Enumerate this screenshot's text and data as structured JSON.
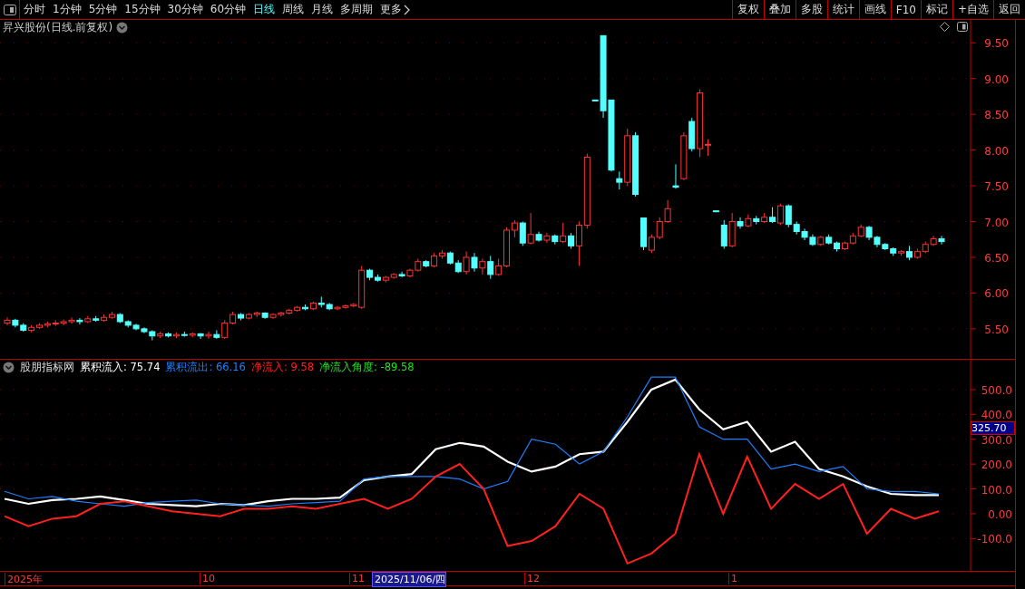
{
  "toolbar": {
    "periods": [
      {
        "label": "分时",
        "selected": false
      },
      {
        "label": "1分钟",
        "selected": false
      },
      {
        "label": "5分钟",
        "selected": false
      },
      {
        "label": "15分钟",
        "selected": false
      },
      {
        "label": "30分钟",
        "selected": false
      },
      {
        "label": "60分钟",
        "selected": false
      },
      {
        "label": "日线",
        "selected": true
      },
      {
        "label": "周线",
        "selected": false
      },
      {
        "label": "月线",
        "selected": false
      },
      {
        "label": "多周期",
        "selected": false
      },
      {
        "label": "更多",
        "selected": false
      }
    ],
    "actions": [
      "复权",
      "叠加",
      "多股",
      "统计",
      "画线",
      "F10",
      "标记",
      "+自选",
      "返回"
    ]
  },
  "main_chart": {
    "title": "昇兴股份(日线.前复权)",
    "chart_data": {
      "type": "candlestick",
      "ylim": [
        5.08,
        9.82
      ],
      "grid": true,
      "yticks": [
        {
          "value": 9.5,
          "label": "9.50"
        },
        {
          "value": 9,
          "label": "9.00"
        },
        {
          "value": 8.5,
          "label": "8.50"
        },
        {
          "value": 8,
          "label": "8.00"
        },
        {
          "value": 7.5,
          "label": "7.50"
        },
        {
          "value": 7,
          "label": "7.00"
        },
        {
          "value": 6.5,
          "label": "6.50"
        },
        {
          "value": 6,
          "label": "6.00"
        },
        {
          "value": 5.5,
          "label": "5.50"
        }
      ],
      "ohlc": [
        [
          5.58,
          5.66,
          5.55,
          5.62
        ],
        [
          5.62,
          5.64,
          5.52,
          5.55
        ],
        [
          5.55,
          5.58,
          5.46,
          5.48
        ],
        [
          5.48,
          5.55,
          5.45,
          5.52
        ],
        [
          5.52,
          5.58,
          5.5,
          5.55
        ],
        [
          5.55,
          5.6,
          5.52,
          5.57
        ],
        [
          5.57,
          5.62,
          5.54,
          5.58
        ],
        [
          5.58,
          5.63,
          5.55,
          5.6
        ],
        [
          5.6,
          5.66,
          5.57,
          5.62
        ],
        [
          5.62,
          5.65,
          5.56,
          5.6
        ],
        [
          5.6,
          5.68,
          5.58,
          5.64
        ],
        [
          5.64,
          5.68,
          5.6,
          5.62
        ],
        [
          5.62,
          5.7,
          5.6,
          5.66
        ],
        [
          5.66,
          5.74,
          5.64,
          5.7
        ],
        [
          5.7,
          5.72,
          5.58,
          5.6
        ],
        [
          5.6,
          5.62,
          5.52,
          5.55
        ],
        [
          5.55,
          5.57,
          5.48,
          5.5
        ],
        [
          5.5,
          5.52,
          5.44,
          5.46
        ],
        [
          5.46,
          5.48,
          5.34,
          5.4
        ],
        [
          5.4,
          5.46,
          5.37,
          5.43
        ],
        [
          5.43,
          5.45,
          5.38,
          5.4
        ],
        [
          5.4,
          5.45,
          5.37,
          5.42
        ],
        [
          5.42,
          5.46,
          5.39,
          5.41
        ],
        [
          5.41,
          5.45,
          5.38,
          5.43
        ],
        [
          5.43,
          5.44,
          5.36,
          5.4
        ],
        [
          5.4,
          5.46,
          5.36,
          5.42
        ],
        [
          5.42,
          5.48,
          5.36,
          5.38
        ],
        [
          5.38,
          5.62,
          5.36,
          5.58
        ],
        [
          5.58,
          5.74,
          5.56,
          5.7
        ],
        [
          5.7,
          5.72,
          5.62,
          5.65
        ],
        [
          5.65,
          5.72,
          5.63,
          5.7
        ],
        [
          5.7,
          5.74,
          5.66,
          5.72
        ],
        [
          5.72,
          5.73,
          5.64,
          5.66
        ],
        [
          5.66,
          5.72,
          5.64,
          5.7
        ],
        [
          5.7,
          5.74,
          5.67,
          5.72
        ],
        [
          5.72,
          5.78,
          5.7,
          5.76
        ],
        [
          5.76,
          5.82,
          5.74,
          5.8
        ],
        [
          5.8,
          5.84,
          5.76,
          5.78
        ],
        [
          5.78,
          5.88,
          5.76,
          5.86
        ],
        [
          5.86,
          5.95,
          5.8,
          5.84
        ],
        [
          5.84,
          5.86,
          5.76,
          5.78
        ],
        [
          5.78,
          5.82,
          5.76,
          5.8
        ],
        [
          5.8,
          5.84,
          5.78,
          5.82
        ],
        [
          5.82,
          5.86,
          5.8,
          5.84
        ],
        [
          5.8,
          6.38,
          5.78,
          6.32
        ],
        [
          6.32,
          6.34,
          6.18,
          6.22
        ],
        [
          6.22,
          6.26,
          6.16,
          6.18
        ],
        [
          6.18,
          6.24,
          6.15,
          6.22
        ],
        [
          6.22,
          6.28,
          6.2,
          6.26
        ],
        [
          6.26,
          6.3,
          6.22,
          6.24
        ],
        [
          6.24,
          6.34,
          6.22,
          6.32
        ],
        [
          6.32,
          6.48,
          6.3,
          6.44
        ],
        [
          6.44,
          6.46,
          6.36,
          6.38
        ],
        [
          6.38,
          6.56,
          6.36,
          6.52
        ],
        [
          6.52,
          6.6,
          6.48,
          6.56
        ],
        [
          6.56,
          6.58,
          6.4,
          6.42
        ],
        [
          6.42,
          6.46,
          6.28,
          6.3
        ],
        [
          6.3,
          6.58,
          6.26,
          6.5
        ],
        [
          6.5,
          6.56,
          6.3,
          6.35
        ],
        [
          6.35,
          6.48,
          6.26,
          6.44
        ],
        [
          6.44,
          6.52,
          6.2,
          6.26
        ],
        [
          6.26,
          6.48,
          6.24,
          6.38
        ],
        [
          6.38,
          6.92,
          6.36,
          6.88
        ],
        [
          6.88,
          7.02,
          6.78,
          6.98
        ],
        [
          6.98,
          7.0,
          6.66,
          6.7
        ],
        [
          6.7,
          7.12,
          6.68,
          6.82
        ],
        [
          6.82,
          6.86,
          6.72,
          6.74
        ],
        [
          6.74,
          6.84,
          6.7,
          6.8
        ],
        [
          6.8,
          6.82,
          6.68,
          6.72
        ],
        [
          6.72,
          6.98,
          6.7,
          6.8
        ],
        [
          6.8,
          6.84,
          6.62,
          6.66
        ],
        [
          6.66,
          7.0,
          6.38,
          6.95
        ],
        [
          6.95,
          7.95,
          6.9,
          7.9
        ],
        [
          8.7,
          8.7,
          8.68,
          8.69
        ],
        [
          9.6,
          9.6,
          8.45,
          8.55
        ],
        [
          8.7,
          8.7,
          7.7,
          7.72
        ],
        [
          7.6,
          7.7,
          7.45,
          7.55
        ],
        [
          7.55,
          8.3,
          7.5,
          8.2
        ],
        [
          8.2,
          8.25,
          7.35,
          7.38
        ],
        [
          7.05,
          7.05,
          6.6,
          6.65
        ],
        [
          6.6,
          6.82,
          6.56,
          6.78
        ],
        [
          6.78,
          7.06,
          6.75,
          7.0
        ],
        [
          7.0,
          7.3,
          6.98,
          7.18
        ],
        [
          7.5,
          7.8,
          7.46,
          7.48
        ],
        [
          7.6,
          8.25,
          7.58,
          8.2
        ],
        [
          8.4,
          8.45,
          7.98,
          8.02
        ],
        [
          8.02,
          8.85,
          7.9,
          8.8
        ],
        [
          8.08,
          8.15,
          7.92,
          8.08
        ],
        [
          7.15,
          7.15,
          7.13,
          7.14
        ],
        [
          6.95,
          7.02,
          6.62,
          6.66
        ],
        [
          6.66,
          7.12,
          6.64,
          7.0
        ],
        [
          7.0,
          7.06,
          6.9,
          6.94
        ],
        [
          6.94,
          7.1,
          6.92,
          7.04
        ],
        [
          7.04,
          7.08,
          6.96,
          7.0
        ],
        [
          7.0,
          7.12,
          6.98,
          7.06
        ],
        [
          7.06,
          7.2,
          6.98,
          7.0
        ],
        [
          6.98,
          7.25,
          6.95,
          7.22
        ],
        [
          7.22,
          7.24,
          6.92,
          6.96
        ],
        [
          6.96,
          7.0,
          6.82,
          6.86
        ],
        [
          6.86,
          6.9,
          6.74,
          6.78
        ],
        [
          6.78,
          6.82,
          6.66,
          6.68
        ],
        [
          6.68,
          6.8,
          6.66,
          6.78
        ],
        [
          6.78,
          6.82,
          6.68,
          6.7
        ],
        [
          6.7,
          6.72,
          6.58,
          6.62
        ],
        [
          6.62,
          6.72,
          6.6,
          6.7
        ],
        [
          6.7,
          6.84,
          6.68,
          6.8
        ],
        [
          6.8,
          6.96,
          6.78,
          6.92
        ],
        [
          6.92,
          6.94,
          6.74,
          6.78
        ],
        [
          6.78,
          6.8,
          6.64,
          6.68
        ],
        [
          6.68,
          6.7,
          6.6,
          6.62
        ],
        [
          6.62,
          6.64,
          6.52,
          6.56
        ],
        [
          6.56,
          6.6,
          6.52,
          6.58
        ],
        [
          6.58,
          6.66,
          6.46,
          6.5
        ],
        [
          6.5,
          6.62,
          6.48,
          6.58
        ],
        [
          6.58,
          6.72,
          6.56,
          6.68
        ],
        [
          6.68,
          6.8,
          6.66,
          6.76
        ],
        [
          6.76,
          6.8,
          6.68,
          6.72
        ]
      ]
    }
  },
  "indicator": {
    "name": "股朋指标网",
    "series_readings": [
      ": 75.74",
      ": 66.16",
      ": 9.58"
    ],
    "extra_reading": {
      "label": "净流入角度",
      "value": ": -89.58",
      "color": "#20e020"
    },
    "cursor_value": "325.70",
    "chart_data": {
      "type": "line",
      "ylim": [
        -230,
        620
      ],
      "grid": true,
      "yticks": [
        {
          "value": 500,
          "label": "500.0"
        },
        {
          "value": 400,
          "label": "400.0"
        },
        {
          "value": 300,
          "label": "300.0"
        },
        {
          "value": 200,
          "label": "200.0"
        },
        {
          "value": 100,
          "label": "100.0"
        },
        {
          "value": 0,
          "label": "0.00"
        },
        {
          "value": -100,
          "label": "-100.0"
        }
      ],
      "series": [
        {
          "name": "累积流入",
          "color": "#ffffff",
          "values": [
            60,
            40,
            55,
            60,
            70,
            55,
            40,
            35,
            30,
            40,
            35,
            50,
            60,
            60,
            65,
            135,
            150,
            160,
            260,
            285,
            270,
            210,
            170,
            190,
            240,
            250,
            370,
            500,
            540,
            420,
            340,
            370,
            250,
            290,
            180,
            150,
            110,
            80,
            75,
            75
          ]
        },
        {
          "name": "累积流出",
          "color": "#1e7fff",
          "values": [
            90,
            60,
            70,
            50,
            40,
            30,
            45,
            50,
            55,
            40,
            35,
            30,
            40,
            45,
            50,
            140,
            150,
            150,
            150,
            140,
            100,
            130,
            300,
            280,
            200,
            250,
            390,
            550,
            550,
            350,
            300,
            300,
            180,
            200,
            170,
            190,
            100,
            90,
            90,
            80
          ]
        },
        {
          "name": "净流入",
          "color": "#ff2020",
          "values": [
            -10,
            -50,
            -20,
            -10,
            40,
            50,
            30,
            10,
            0,
            -10,
            20,
            20,
            30,
            20,
            40,
            60,
            20,
            60,
            150,
            200,
            100,
            -130,
            -110,
            -50,
            80,
            20,
            -200,
            -160,
            -80,
            240,
            0,
            230,
            20,
            120,
            60,
            120,
            -80,
            20,
            -20,
            10
          ]
        }
      ]
    }
  },
  "date_axis": {
    "labels": [
      {
        "label": "2025年",
        "selected": false
      },
      {
        "label": "10",
        "selected": false
      },
      {
        "label": "11",
        "selected": false
      },
      {
        "label": "2025/11/06/四",
        "selected": true
      },
      {
        "label": "12",
        "selected": false
      },
      {
        "label": "1",
        "selected": false
      }
    ]
  }
}
